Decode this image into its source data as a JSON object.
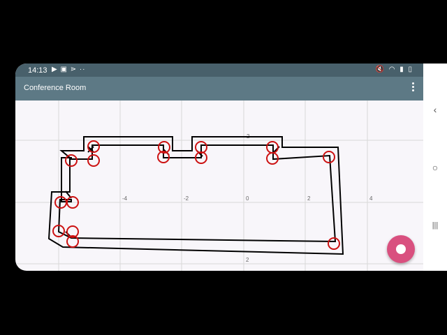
{
  "status": {
    "time": "14:13",
    "left_icons": "▶ ▣ ⋗ ··",
    "right_icons": "🔇 ◠ ▮ ▯"
  },
  "appbar": {
    "title": "Conference Room"
  },
  "canvas": {
    "axis_labels_x": [
      "-4",
      "-2",
      "0",
      "2",
      "4"
    ],
    "axis_labels_y": [
      "2",
      "2"
    ]
  },
  "navbar": {
    "back": "‹",
    "home": "○",
    "recents": "|||"
  },
  "colors": {
    "appbar": "#5d7985",
    "statusbar": "#48606b",
    "fab": "#d9507f",
    "marker": "#cc1111"
  }
}
